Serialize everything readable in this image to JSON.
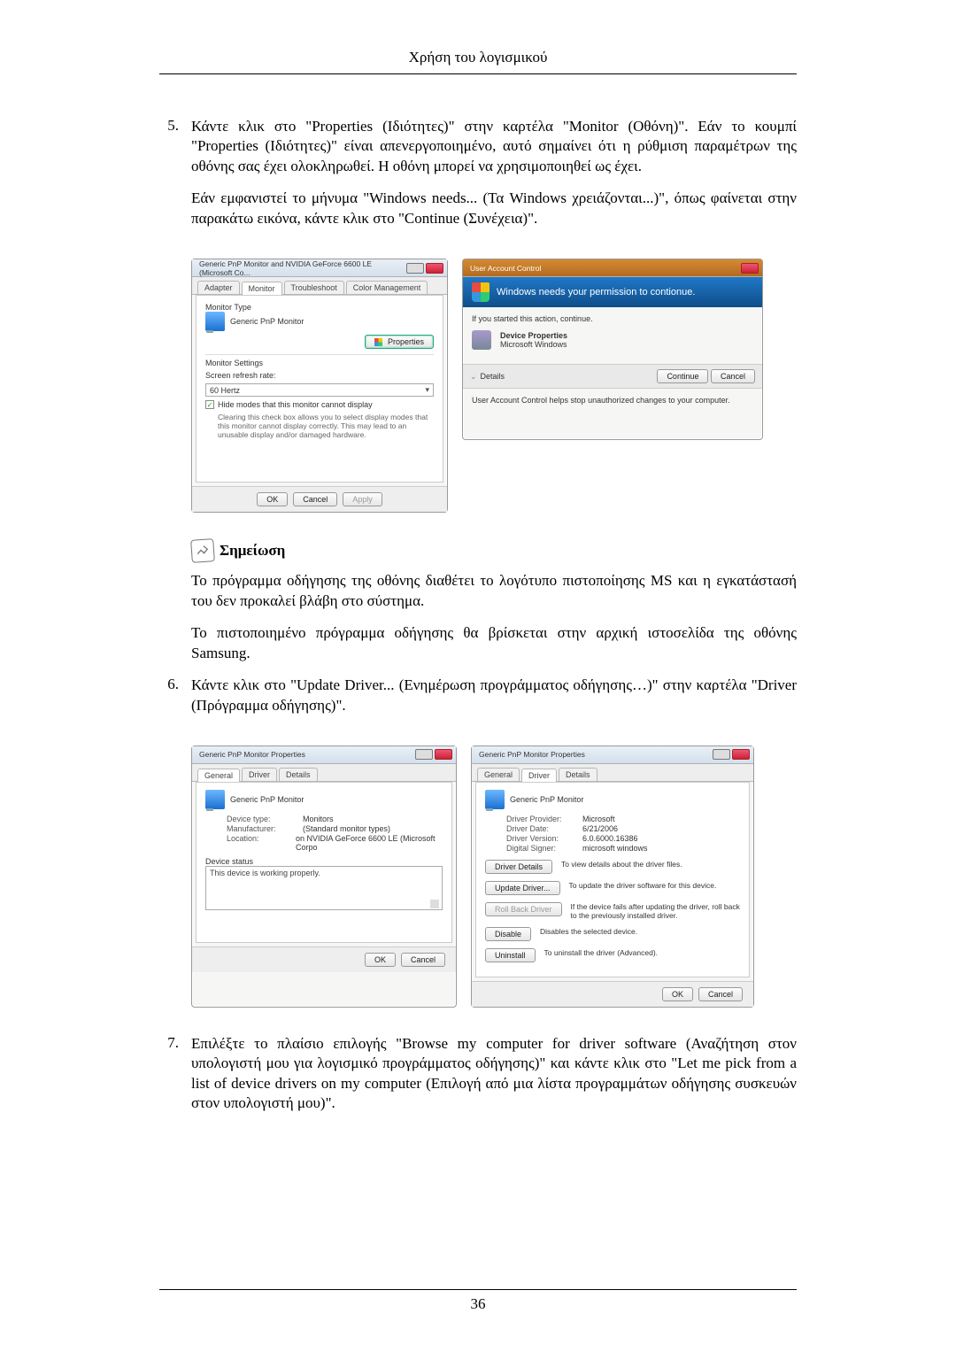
{
  "page_header": "Χρήση του λογισμικού",
  "page_number": "36",
  "step5": {
    "num": "5.",
    "p1": "Κάντε κλικ στο \"Properties (Ιδιότητες)\" στην καρτέλα \"Monitor (Οθόνη)\". Εάν το κουμπί \"Properties (Ιδιότητες)\" είναι απενεργοποιημένο, αυτό σημαίνει ότι η ρύθμιση παραμέτρων της οθόνης σας έχει ολοκληρωθεί. Η οθόνη μπορεί να χρησιμοποιηθεί ως έχει.",
    "p2": "Εάν εμφανιστεί το μήνυμα \"Windows needs... (Τα Windows χρειάζονται...)\", όπως φαίνεται στην παρακάτω εικόνα, κάντε κλικ στο \"Continue (Συνέχεια)\"."
  },
  "note": {
    "title": "Σημείωση",
    "p1": "Το πρόγραμμα οδήγησης της οθόνης διαθέτει το λογότυπο πιστοποίησης MS και η εγκατάστασή του δεν προκαλεί βλάβη στο σύστημα.",
    "p2": "Το πιστοποιημένο πρόγραμμα οδήγησης θα βρίσκεται στην αρχική ιστοσελίδα της οθόνης Samsung."
  },
  "step6": {
    "num": "6.",
    "p1": "Κάντε κλικ στο \"Update Driver... (Ενημέρωση προγράμματος οδήγησης…)\" στην καρτέλα \"Driver (Πρόγραμμα οδήγησης)\"."
  },
  "step7": {
    "num": "7.",
    "p1": "Επιλέξτε το πλαίσιο επιλογής \"Browse my computer for driver software (Αναζήτηση στον υπολογιστή μου για λογισμικό προγράμματος οδήγησης)\" και κάντε κλικ στο \"Let me pick from a list of device drivers on my computer (Επιλογή από μια λίστα προγραμμάτων οδήγησης συσκευών στον υπολογιστή μου)\"."
  },
  "fig1_left": {
    "title": "Generic PnP Monitor and NVIDIA GeForce 6600 LE (Microsoft Co...",
    "tabs": [
      "Adapter",
      "Monitor",
      "Troubleshoot",
      "Color Management"
    ],
    "sec_monitor_type": "Monitor Type",
    "monitor_name": "Generic PnP Monitor",
    "properties_btn": "Properties",
    "sec_monitor_settings": "Monitor Settings",
    "refresh_label": "Screen refresh rate:",
    "refresh_value": "60 Hertz",
    "hide_modes_label": "Hide modes that this monitor cannot display",
    "hide_modes_desc": "Clearing this check box allows you to select display modes that this monitor cannot display correctly. This may lead to an unusable display and/or damaged hardware.",
    "ok": "OK",
    "cancel": "Cancel",
    "apply": "Apply"
  },
  "fig1_right": {
    "title": "User Account Control",
    "headline": "Windows needs your permission to contionue.",
    "started": "If you started this action, continue.",
    "dev_props": "Device Properties",
    "ms_windows": "Microsoft Windows",
    "details": "Details",
    "continue": "Continue",
    "cancel": "Cancel",
    "footnote": "User Account Control helps stop unauthorized changes to your computer."
  },
  "fig2_left": {
    "title": "Generic PnP Monitor Properties",
    "tabs": [
      "General",
      "Driver",
      "Details"
    ],
    "dev_name": "Generic PnP Monitor",
    "rows": {
      "device_type_k": "Device type:",
      "device_type_v": "Monitors",
      "manufacturer_k": "Manufacturer:",
      "manufacturer_v": "(Standard monitor types)",
      "location_k": "Location:",
      "location_v": "on NVIDIA GeForce 6600 LE (Microsoft Corpo"
    },
    "device_status_lbl": "Device status",
    "device_status_text": "This device is working properly.",
    "ok": "OK",
    "cancel": "Cancel"
  },
  "fig2_right": {
    "title": "Generic PnP Monitor Properties",
    "tabs": [
      "General",
      "Driver",
      "Details"
    ],
    "dev_name": "Generic PnP Monitor",
    "rows": {
      "provider_k": "Driver Provider:",
      "provider_v": "Microsoft",
      "date_k": "Driver Date:",
      "date_v": "6/21/2006",
      "version_k": "Driver Version:",
      "version_v": "6.0.6000.16386",
      "signer_k": "Digital Signer:",
      "signer_v": "microsoft windows"
    },
    "btns": {
      "details": "Driver Details",
      "details_desc": "To view details about the driver files.",
      "update": "Update Driver...",
      "update_desc": "To update the driver software for this device.",
      "rollback": "Roll Back Driver",
      "rollback_desc": "If the device fails after updating the driver, roll back to the previously installed driver.",
      "disable": "Disable",
      "disable_desc": "Disables the selected device.",
      "uninstall": "Uninstall",
      "uninstall_desc": "To uninstall the driver (Advanced)."
    },
    "ok": "OK",
    "cancel": "Cancel"
  }
}
